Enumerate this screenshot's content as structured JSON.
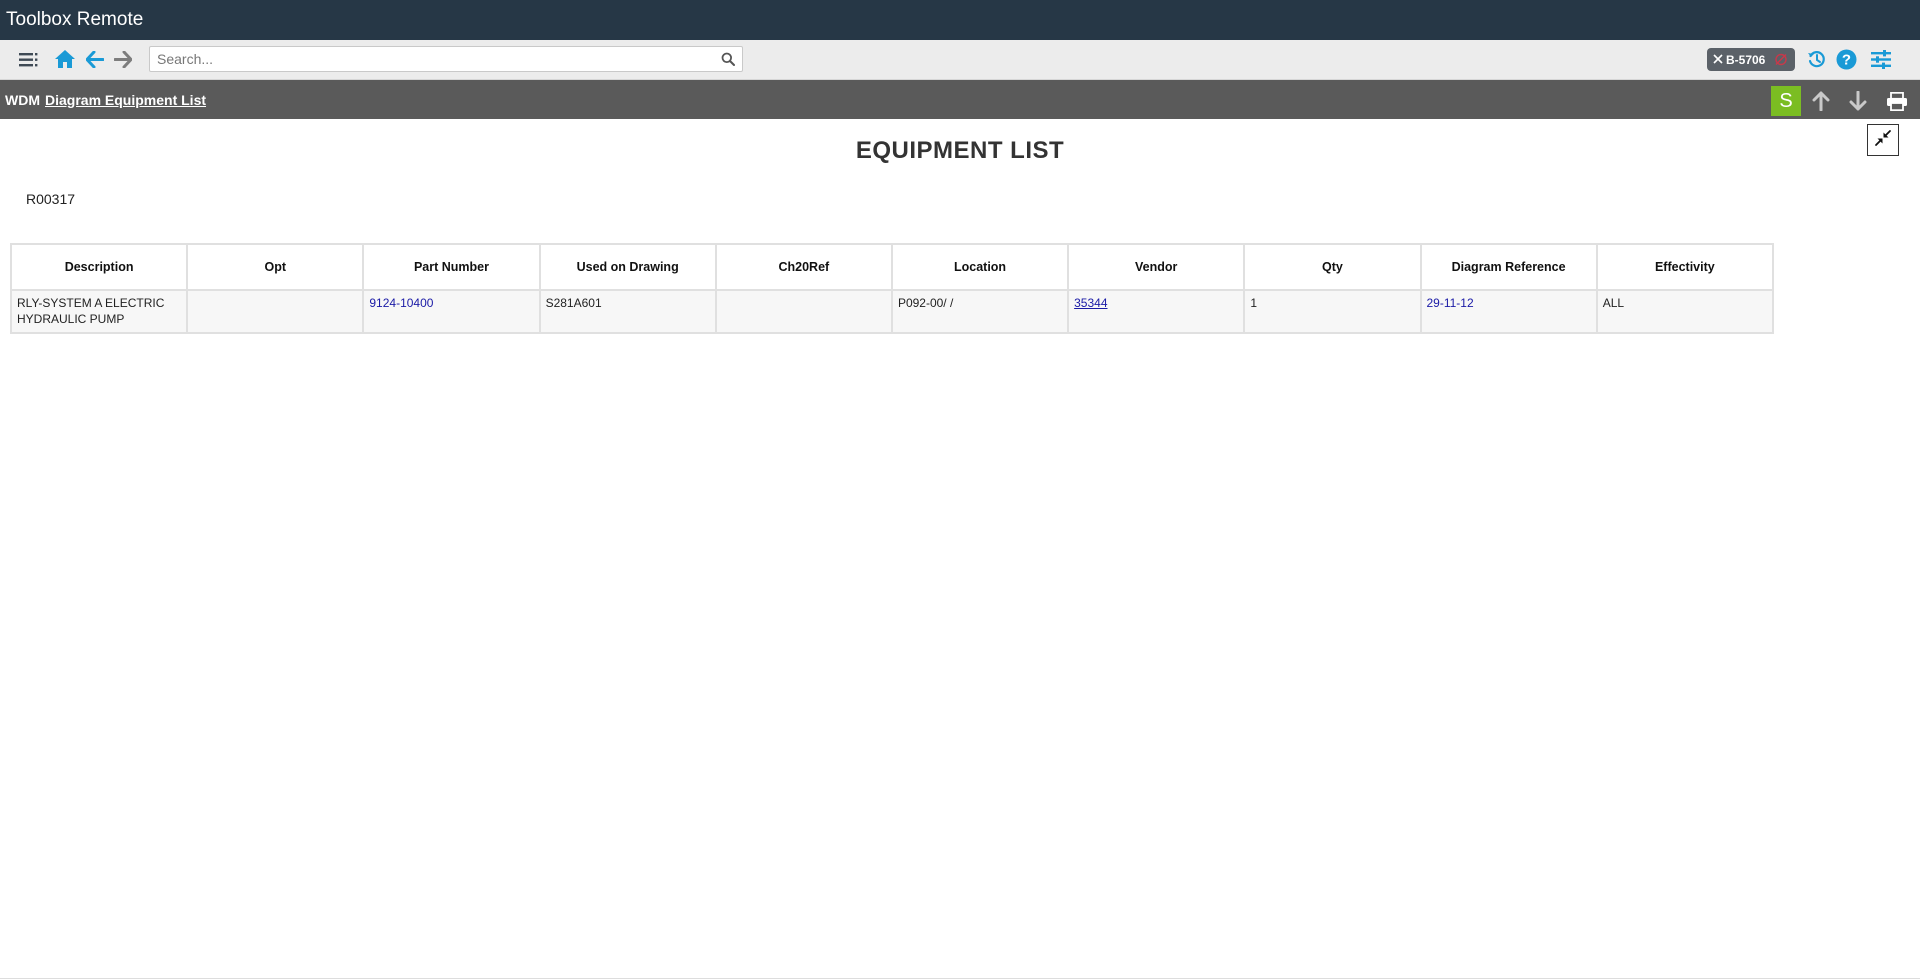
{
  "window": {
    "title": "Toolbox Remote"
  },
  "toolbar": {
    "search_placeholder": "Search...",
    "tail_number": "B-5706"
  },
  "subheader": {
    "root": "WDM",
    "link": "Diagram Equipment List",
    "s_button": "S"
  },
  "page": {
    "title": "EQUIPMENT LIST",
    "drawing_id": "R00317"
  },
  "table": {
    "headers": [
      "Description",
      "Opt",
      "Part Number",
      "Used on Drawing",
      "Ch20Ref",
      "Location",
      "Vendor",
      "Qty",
      "Diagram Reference",
      "Effectivity"
    ],
    "rows": [
      {
        "description": "RLY-SYSTEM A ELECTRIC HYDRAULIC PUMP",
        "opt": "",
        "part_number": "9124-10400",
        "used_on_drawing": "S281A601",
        "ch20ref": "",
        "location": "P092-00/ /",
        "vendor": "35344",
        "qty": "1",
        "diagram_reference": "29-11-12",
        "effectivity": "ALL"
      }
    ]
  },
  "colors": {
    "titlebar": "#263746",
    "accent_blue": "#1a9ad6",
    "subheader": "#5a5a5a",
    "s_button": "#7bbd22",
    "link": "#1a1aa6"
  }
}
